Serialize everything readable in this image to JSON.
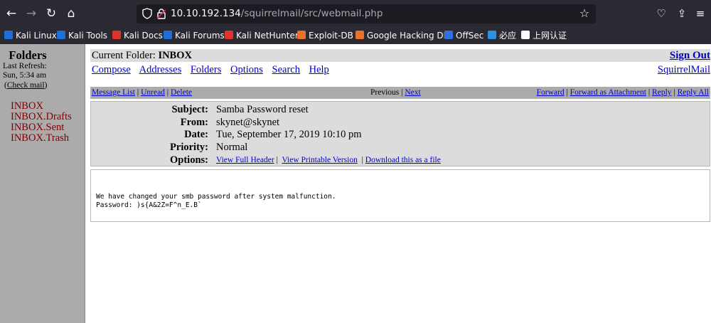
{
  "browser": {
    "url_host": "10.10.192.134",
    "url_path": "/squirrelmail/src/webmail.php",
    "bookmarks": [
      {
        "label": "Kali Linux",
        "color": "#1e6fd9"
      },
      {
        "label": "Kali Tools",
        "color": "#1e6fd9"
      },
      {
        "label": "Kali Docs",
        "color": "#e0332b"
      },
      {
        "label": "Kali Forums",
        "color": "#1e6fd9"
      },
      {
        "label": "Kali NetHunter",
        "color": "#e0332b"
      },
      {
        "label": "Exploit-DB",
        "color": "#e8722a"
      },
      {
        "label": "Google Hacking DB",
        "color": "#e8722a"
      },
      {
        "label": "OffSec",
        "color": "#2f6fe0"
      },
      {
        "label": "必应",
        "color": "#2f8fe0"
      },
      {
        "label": "上网认证",
        "color": "#fbfbfe"
      }
    ]
  },
  "left": {
    "title": "Folders",
    "refresh_label": "Last Refresh:",
    "refresh_time": "Sun, 5:34 am",
    "check_mail": "Check mail",
    "folders": [
      "INBOX",
      "INBOX.Drafts",
      "INBOX.Sent",
      "INBOX.Trash"
    ]
  },
  "top": {
    "current_folder_label": "Current Folder:",
    "current_folder": "INBOX",
    "sign_out": "Sign Out",
    "menu": [
      "Compose",
      "Addresses",
      "Folders",
      "Options",
      "Search",
      "Help"
    ],
    "squirrelmail": "SquirrelMail"
  },
  "nav": {
    "message_list": "Message List",
    "unread": "Unread",
    "delete": "Delete",
    "previous": "Previous",
    "next": "Next",
    "forward": "Forward",
    "forward_attachment": "Forward as Attachment",
    "reply": "Reply",
    "reply_all": "Reply All"
  },
  "headers": {
    "subject_label": "Subject:",
    "subject": "Samba Password reset",
    "from_label": "From:",
    "from": "skynet@skynet",
    "date_label": "Date:",
    "date": "Tue, September 17, 2019 10:10 pm",
    "priority_label": "Priority:",
    "priority": "Normal",
    "options_label": "Options:",
    "view_full_header": "View Full Header",
    "view_printable": "View Printable Version",
    "download": "Download this as a file"
  },
  "message": {
    "line1": "We have changed your smb password after system malfunction.",
    "line2": "Password: )s{A&2Z=F^n_E.B`"
  },
  "colors": {
    "link": "#0000cc",
    "folder_link": "#800000",
    "sidebar_bg": "#ababab",
    "bar_bg": "#dcdcdc"
  }
}
